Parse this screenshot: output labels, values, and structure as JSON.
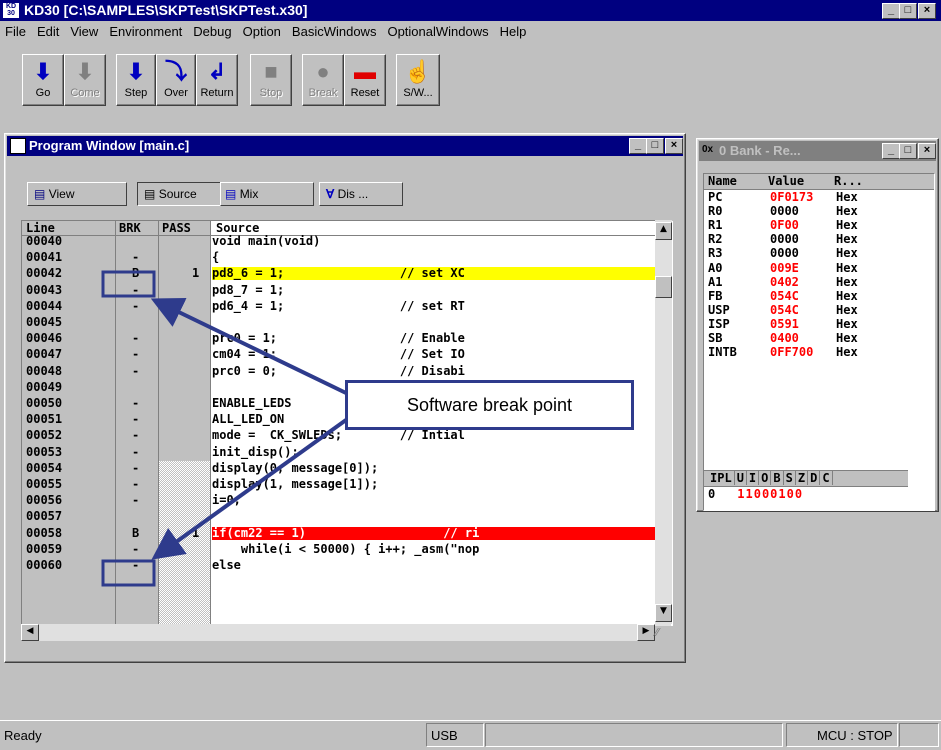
{
  "app": {
    "title": "KD30 [C:\\SAMPLES\\SKPTest\\SKPTest.x30]",
    "icon_text": "KD 30"
  },
  "menu": [
    "File",
    "Edit",
    "View",
    "Environment",
    "Debug",
    "Option",
    "BasicWindows",
    "OptionalWindows",
    "Help"
  ],
  "toolbar": {
    "go": "Go",
    "come": "Come",
    "step": "Step",
    "over": "Over",
    "return": "Return",
    "stop": "Stop",
    "break": "Break",
    "reset": "Reset",
    "sw": "S/W..."
  },
  "program_window": {
    "title": "Program Window [main.c]",
    "tabs": {
      "view": "View",
      "source": "Source",
      "mix": "Mix",
      "dis": "Dis ..."
    },
    "columns": {
      "line": "Line",
      "brk": "BRK",
      "pass": "PASS",
      "source": "Source"
    },
    "rows": [
      {
        "line": "00040",
        "brk": "",
        "pass": "",
        "src": "void main(void)"
      },
      {
        "line": "00041",
        "brk": "-",
        "pass": "",
        "src": "{"
      },
      {
        "line": "00042",
        "brk": "B",
        "pass": "1",
        "src": "pd8_6 = 1;                // set XC"
      },
      {
        "line": "00043",
        "brk": "-",
        "pass": "",
        "src": "pd8_7 = 1;"
      },
      {
        "line": "00044",
        "brk": "-",
        "pass": "",
        "src": "pd6_4 = 1;                // set RT"
      },
      {
        "line": "00045",
        "brk": "",
        "pass": "",
        "src": ""
      },
      {
        "line": "00046",
        "brk": "-",
        "pass": "",
        "src": "prc0 = 1;                 // Enable"
      },
      {
        "line": "00047",
        "brk": "-",
        "pass": "",
        "src": "cm04 = 1;                 // Set IO"
      },
      {
        "line": "00048",
        "brk": "-",
        "pass": "",
        "src": "prc0 = 0;                 // Disabi"
      },
      {
        "line": "00049",
        "brk": "",
        "pass": "",
        "src": ""
      },
      {
        "line": "00050",
        "brk": "-",
        "pass": "",
        "src": "ENABLE_LEDS"
      },
      {
        "line": "00051",
        "brk": "-",
        "pass": "",
        "src": "ALL_LED_ON"
      },
      {
        "line": "00052",
        "brk": "-",
        "pass": "",
        "src": "mode =  CK_SWLEDs;        // Intial"
      },
      {
        "line": "00053",
        "brk": "-",
        "pass": "",
        "src": "init_disp();"
      },
      {
        "line": "00054",
        "brk": "-",
        "pass": "",
        "src": "display(0, message[0]);"
      },
      {
        "line": "00055",
        "brk": "-",
        "pass": "",
        "src": "display(1, message[1]);"
      },
      {
        "line": "00056",
        "brk": "-",
        "pass": "",
        "src": "i=0;"
      },
      {
        "line": "00057",
        "brk": "",
        "pass": "",
        "src": ""
      },
      {
        "line": "00058",
        "brk": "B",
        "pass": "1",
        "src": "if(cm22 == 1)                   // ri"
      },
      {
        "line": "00059",
        "brk": "-",
        "pass": "",
        "src": "    while(i < 50000) { i++; _asm(\"nop"
      },
      {
        "line": "00060",
        "brk": "-",
        "pass": "",
        "src": "else"
      },
      {
        "line": "",
        "brk": "",
        "pass": "",
        "src": ""
      }
    ]
  },
  "callout": {
    "text": "Software break point"
  },
  "reg_window": {
    "title": "0 Bank - Re...",
    "icon_text": "0x",
    "columns": {
      "name": "Name",
      "value": "Value",
      "radix": "R..."
    },
    "rows": [
      {
        "name": "PC",
        "value": "0F0173",
        "radix": "Hex"
      },
      {
        "name": "R0",
        "value": "0000",
        "radix": "Hex"
      },
      {
        "name": "R1",
        "value": "0F00",
        "radix": "Hex"
      },
      {
        "name": "R2",
        "value": "0000",
        "radix": "Hex"
      },
      {
        "name": "R3",
        "value": "0000",
        "radix": "Hex"
      },
      {
        "name": "A0",
        "value": "009E",
        "radix": "Hex"
      },
      {
        "name": "A1",
        "value": "0402",
        "radix": "Hex"
      },
      {
        "name": "FB",
        "value": "054C",
        "radix": "Hex"
      },
      {
        "name": "USP",
        "value": "054C",
        "radix": "Hex"
      },
      {
        "name": "ISP",
        "value": "0591",
        "radix": "Hex"
      },
      {
        "name": "SB",
        "value": "0400",
        "radix": "Hex"
      },
      {
        "name": "INTB",
        "value": "0FF700",
        "radix": "Hex"
      }
    ],
    "flags_header": [
      "IPL",
      "U",
      "I",
      "O",
      "B",
      "S",
      "Z",
      "D",
      "C"
    ],
    "flags_values": {
      "ipl": "0",
      "bits": [
        "1",
        "1",
        "0",
        "0",
        "0",
        "1",
        "0",
        "0"
      ]
    }
  },
  "statusbar": {
    "ready": "Ready",
    "usb": "USB",
    "mcu": "MCU : STOP"
  },
  "colors": {
    "titlebar": "#000080",
    "highlight_yellow": "#ffff00",
    "highlight_red": "#ff0000",
    "callout_border": "#2e3b8c",
    "reg_changed": "#ff0000"
  }
}
